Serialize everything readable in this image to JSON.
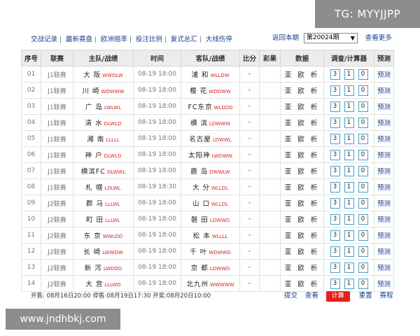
{
  "watermarks": {
    "top_right": "TG: MYYJJPP",
    "bottom_left": "www.jndhbkj.com"
  },
  "toolbar": {
    "links": [
      "交战记录",
      "最新赛盘",
      "欧洲赔率",
      "投注比例",
      "复式总汇",
      "大线伤停"
    ],
    "period_label": "返回本期",
    "period_value": "第20024期",
    "more_label": "查看更多"
  },
  "table": {
    "headers": [
      "序号",
      "联赛",
      "主队/战绩",
      "时间",
      "客队/战绩",
      "比分",
      "彩果",
      "数据",
      "调查/计算器",
      "预测"
    ],
    "data_label": "亚 欧 析",
    "predict_label": "预测",
    "box_values": [
      "3",
      "1",
      "0"
    ],
    "rows": [
      {
        "num": "01",
        "league": "J1联赛",
        "home": "大 阪",
        "home_form": "WWDLW",
        "time": "08-19 18:00",
        "away": "浦 和",
        "away_form": "WLLDW",
        "score": "-"
      },
      {
        "num": "02",
        "league": "J1联赛",
        "home": "川 崎",
        "home_form": "WDWWW",
        "time": "08-19 18:00",
        "away": "樱 花",
        "away_form": "WDDWW",
        "score": "-"
      },
      {
        "num": "03",
        "league": "J1联赛",
        "home": "广 岛",
        "home_form": "LWLWL",
        "time": "08-19 18:00",
        "away": "FC东京",
        "away_form": "WLDDD",
        "score": "-"
      },
      {
        "num": "04",
        "league": "J1联赛",
        "home": "清 水",
        "home_form": "DLWLD",
        "time": "08-19 18:00",
        "away": "横 滨",
        "away_form": "LDWWW",
        "score": "-"
      },
      {
        "num": "05",
        "league": "J1联赛",
        "home": "湘 南",
        "home_form": "LLLLL",
        "time": "08-19 18:00",
        "away": "名古屋",
        "away_form": "LDWWL",
        "score": "-"
      },
      {
        "num": "06",
        "league": "J1联赛",
        "home": "神 户",
        "home_form": "DLWLD",
        "time": "08-19 18:00",
        "away": "太阳神",
        "away_form": "LWDWW",
        "score": "-"
      },
      {
        "num": "07",
        "league": "J1联赛",
        "home": "横滨FC",
        "home_form": "DLWWL",
        "time": "08-19 18:00",
        "away": "鹿 岛",
        "away_form": "DWWLW",
        "score": "-"
      },
      {
        "num": "08",
        "league": "J1联赛",
        "home": "札 幌",
        "home_form": "LDLWL",
        "time": "08-19 18:30",
        "away": "大 分",
        "away_form": "WLLDL",
        "score": "-"
      },
      {
        "num": "09",
        "league": "J2联赛",
        "home": "群 马",
        "home_form": "LLLWL",
        "time": "08-19 18:00",
        "away": "山 口",
        "away_form": "WLLDL",
        "score": "-"
      },
      {
        "num": "10",
        "league": "J2联赛",
        "home": "町 田",
        "home_form": "LLLWL",
        "time": "08-19 18:00",
        "away": "磐 田",
        "away_form": "LDWWD",
        "score": "-"
      },
      {
        "num": "11",
        "league": "J2联赛",
        "home": "东 京",
        "home_form": "WWLDD",
        "time": "08-19 18:00",
        "away": "松 本",
        "away_form": "WLLLL",
        "score": "-"
      },
      {
        "num": "12",
        "league": "J2联赛",
        "home": "长 崎",
        "home_form": "LWWDW",
        "time": "08-19 18:00",
        "away": "千 叶",
        "away_form": "WDWWD",
        "score": "-"
      },
      {
        "num": "13",
        "league": "J2联赛",
        "home": "新 泻",
        "home_form": "LWDDD",
        "time": "08-19 18:00",
        "away": "京 都",
        "away_form": "LDWWD",
        "score": "-"
      },
      {
        "num": "14",
        "league": "J2联赛",
        "home": "大 宫",
        "home_form": "LLLWD",
        "time": "08-19 18:00",
        "away": "北九州",
        "away_form": "WWWWW",
        "score": "-"
      }
    ]
  },
  "footer": {
    "info": "开售: 08月16日20:00  停售:08月19日17:30  开奖:08月20日10:00",
    "submit": "提交",
    "view": "查看",
    "calculate": "计算",
    "reset": "重置",
    "schedule": "赛程"
  },
  "colors": {
    "link": "#1a3e8c",
    "form": "#dd2222",
    "calc_button": "#e3201b",
    "box_border": "#4a9ec9"
  }
}
